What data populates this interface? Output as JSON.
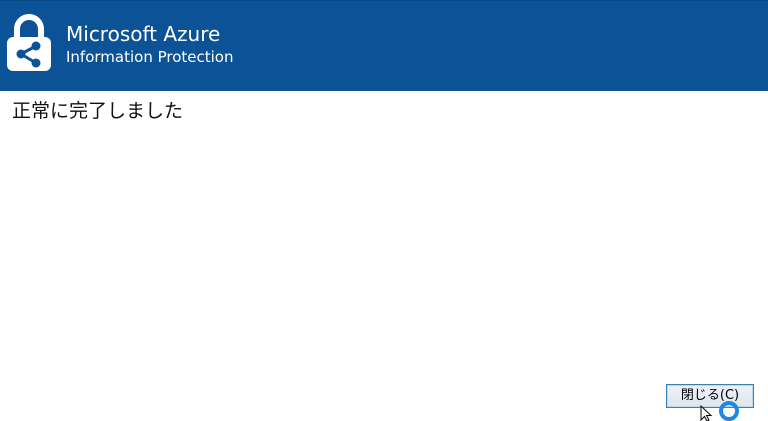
{
  "header": {
    "title": "Microsoft Azure",
    "subtitle": "Information Protection",
    "background_color": "#0b5396",
    "logo_icon": "lock-share-icon"
  },
  "main": {
    "status_message": "正常に完了しました"
  },
  "footer": {
    "close_label": "閉じる(C)"
  },
  "pointer": {
    "icon": "busy-cursor-icon"
  }
}
